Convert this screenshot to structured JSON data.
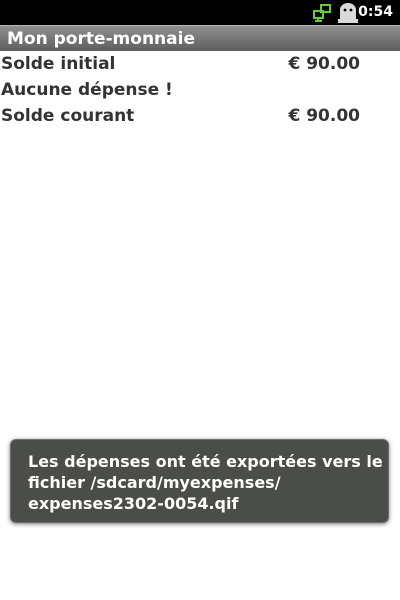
{
  "status_bar": {
    "time": "0:54",
    "icons": [
      "data-sync-icon",
      "usb-debug-icon"
    ]
  },
  "title_bar": {
    "title": "Mon porte-monnaie"
  },
  "summary": {
    "rows": [
      {
        "label": "Solde initial",
        "value": "€ 90.00"
      },
      {
        "label": "Aucune dépense !",
        "value": ""
      },
      {
        "label": "Solde courant",
        "value": "€ 90.00"
      }
    ]
  },
  "toast": {
    "lines": [
      "Les dépenses ont été exportées vers le",
      "fichier /sdcard/myexpenses/",
      "expenses2302-0054.qif"
    ]
  },
  "colors": {
    "status_bar_bg": "#000000",
    "title_bar_bg": "#7a7a7a",
    "text": "#333333",
    "toast_bg": "#4a4d4a",
    "status_icon_green": "#66cc33"
  }
}
